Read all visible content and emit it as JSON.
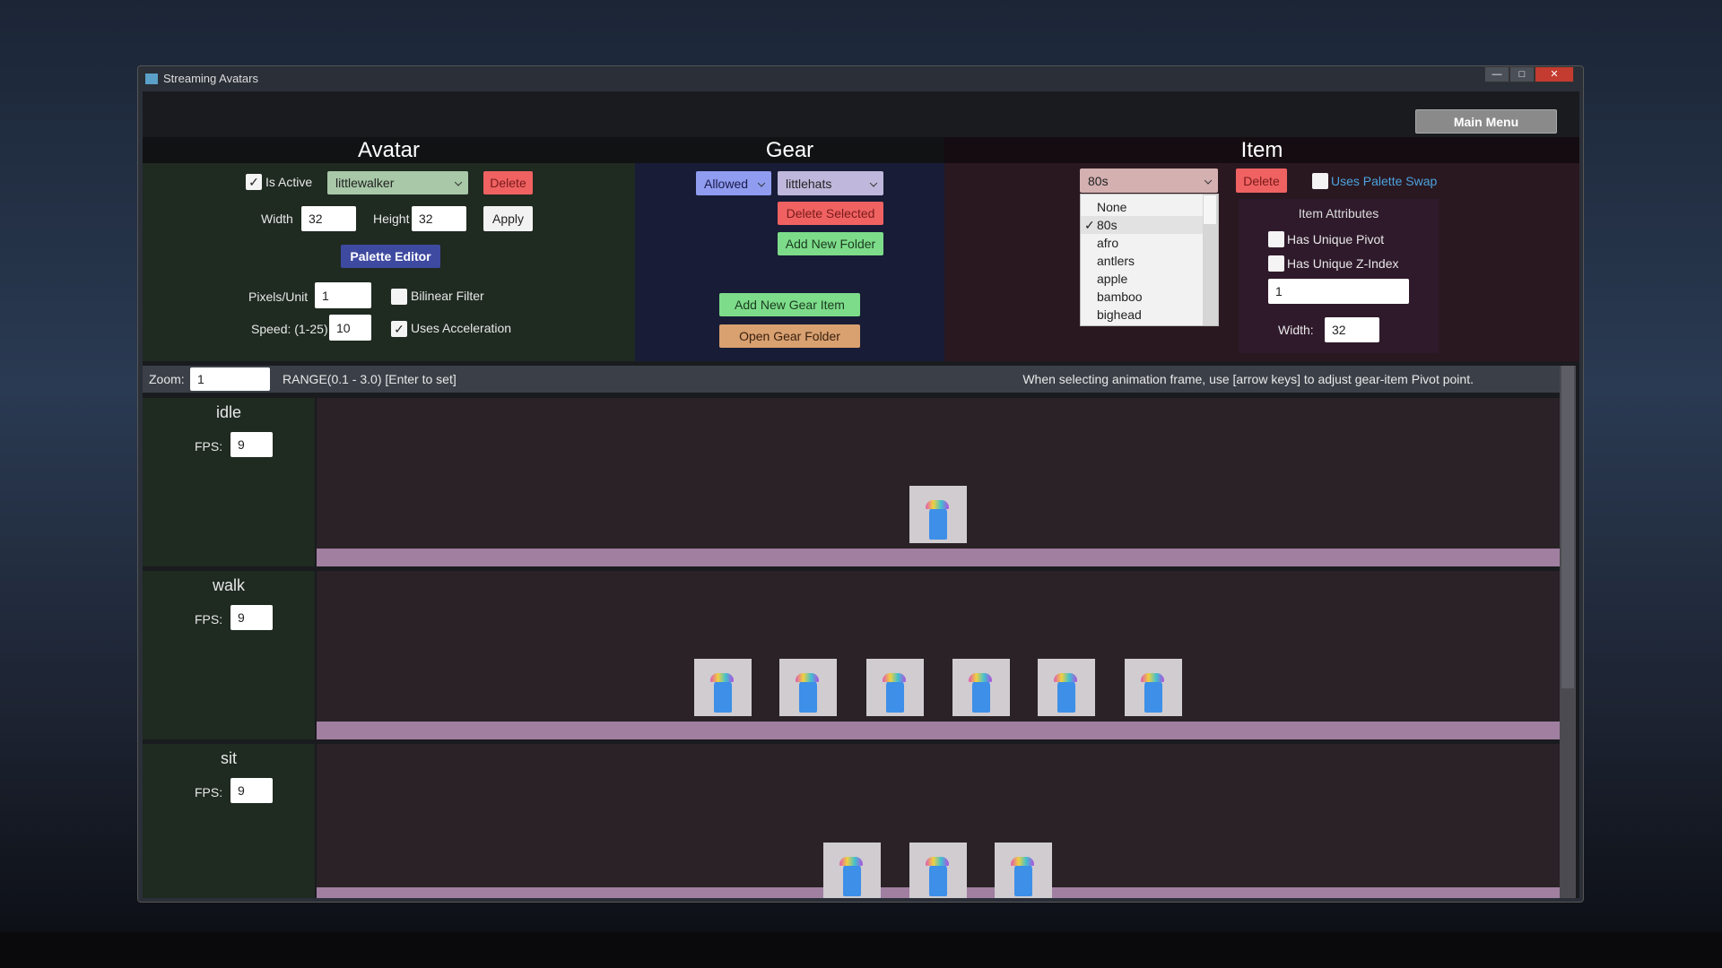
{
  "window": {
    "title": "Streaming Avatars",
    "minimize": "—",
    "maximize": "□",
    "close": "✕"
  },
  "main_menu": "Main Menu",
  "avatar": {
    "header": "Avatar",
    "is_active_label": "Is Active",
    "is_active": true,
    "selected": "littlewalker",
    "delete": "Delete",
    "width_label": "Width",
    "width": "32",
    "height_label": "Height",
    "height": "32",
    "apply": "Apply",
    "palette_editor": "Palette Editor",
    "pixels_unit_label": "Pixels/Unit",
    "pixels_unit": "1",
    "bilinear_label": "Bilinear Filter",
    "bilinear": false,
    "speed_label": "Speed: (1-25)",
    "speed": "10",
    "accel_label": "Uses Acceleration",
    "accel": true
  },
  "gear": {
    "header": "Gear",
    "filter": "Allowed",
    "folder": "littlehats",
    "delete_selected": "Delete Selected",
    "add_folder": "Add New Folder",
    "add_item": "Add New Gear Item",
    "open_folder": "Open Gear Folder"
  },
  "item": {
    "header": "Item",
    "selected": "80s",
    "delete": "Delete",
    "palette_swap_label": "Uses Palette Swap",
    "palette_swap": false,
    "options": [
      "None",
      "80s",
      "afro",
      "antlers",
      "apple",
      "bamboo",
      "bighead"
    ],
    "check": "✓",
    "attributes_label": "Item Attributes",
    "unique_pivot_label": "Has Unique Pivot",
    "unique_z_label": "Has Unique Z-Index",
    "z_index": "1",
    "width_label": "Width:",
    "width": "32"
  },
  "zoombar": {
    "label": "Zoom:",
    "value": "1",
    "range": "RANGE(0.1 - 3.0) [Enter to set]",
    "hint": "When selecting animation frame, use [arrow keys] to adjust gear-item Pivot point."
  },
  "animations": [
    {
      "name": "idle",
      "fps_label": "FPS:",
      "fps": "9",
      "frames": 1
    },
    {
      "name": "walk",
      "fps_label": "FPS:",
      "fps": "9",
      "frames": 6
    },
    {
      "name": "sit",
      "fps_label": "FPS:",
      "fps": "9",
      "frames": 3
    }
  ],
  "colors": {
    "delete": "#f06262",
    "green": "#7ddc8a",
    "palette": "#3e4aa0",
    "link": "#4aa3df",
    "bar": "#a07fa0"
  }
}
